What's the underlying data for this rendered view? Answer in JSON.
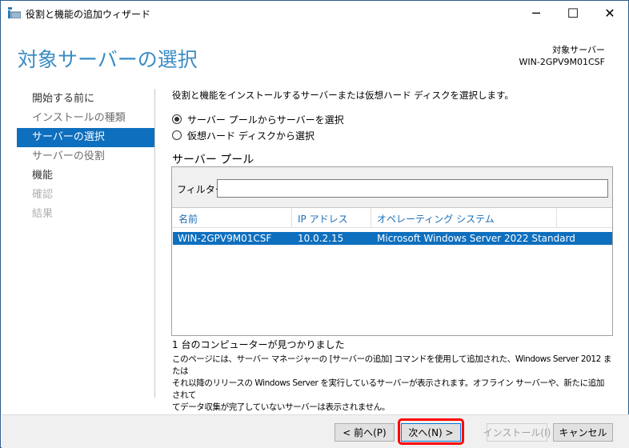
{
  "window": {
    "title": "役割と機能の追加ウィザード",
    "icon": "server-manager-icon",
    "controls": {
      "minimize": "─",
      "maximize": "☐",
      "close": "✕"
    }
  },
  "header": {
    "title": "対象サーバーの選択",
    "target_label": "対象サーバー",
    "target_server": "WIN-2GPV9M01CSF"
  },
  "nav": {
    "items": [
      {
        "label": "開始する前に",
        "state": "normal"
      },
      {
        "label": "インストールの種類",
        "state": "muted"
      },
      {
        "label": "サーバーの選択",
        "state": "selected"
      },
      {
        "label": "サーバーの役割",
        "state": "muted"
      },
      {
        "label": "機能",
        "state": "normal"
      },
      {
        "label": "確認",
        "state": "disabled"
      },
      {
        "label": "結果",
        "state": "disabled"
      }
    ]
  },
  "main": {
    "description": "役割と機能をインストールするサーバーまたは仮想ハード ディスクを選択します。",
    "radios": [
      {
        "label": "サーバー プールからサーバーを選択",
        "checked": true
      },
      {
        "label": "仮想ハード ディスクから選択",
        "checked": false
      }
    ],
    "pool_title": "サーバー プール",
    "filter_label": "フィルター:",
    "filter_value": "",
    "columns": [
      "名前",
      "IP アドレス",
      "オペレーティング システム"
    ],
    "rows": [
      {
        "name": "WIN-2GPV9M01CSF",
        "ip": "10.0.2.15",
        "os": "Microsoft Windows Server 2022 Standard",
        "selected": true
      }
    ],
    "count_text": "1 台のコンピューターが見つかりました",
    "info_lines": [
      "このページには、サーバー マネージャーの [サーバーの追加] コマンドを使用して追加された、Windows Server 2012 または",
      "それ以降のリリースの Windows Server を実行しているサーバーが表示されます。オフライン サーバーや、新たに追加されて",
      "てデータ収集が完了していないサーバーは表示されません。"
    ]
  },
  "footer": {
    "prev": "< 前へ(P)",
    "next": "次へ(N) >",
    "install": "インストール(I)",
    "cancel": "キャンセル"
  },
  "colors": {
    "accent": "#0e6fbe",
    "heading": "#3a8cc4",
    "highlight": "#ff0000"
  }
}
